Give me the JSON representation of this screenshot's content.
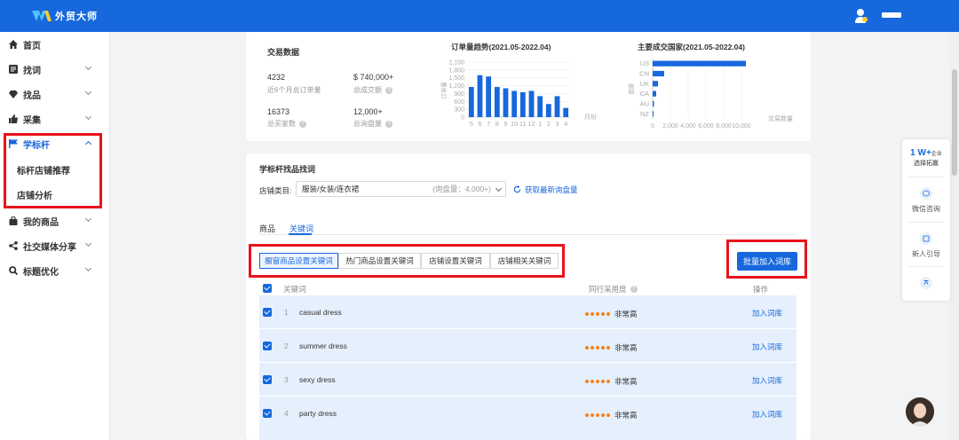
{
  "app": {
    "title": "外贸大师"
  },
  "sidebar": {
    "items": [
      {
        "label": "首页"
      },
      {
        "label": "找词"
      },
      {
        "label": "找品"
      },
      {
        "label": "采集"
      },
      {
        "label": "学标杆"
      },
      {
        "label": "我的商品"
      },
      {
        "label": "社交媒体分享"
      },
      {
        "label": "标题优化"
      }
    ],
    "subitems": [
      {
        "label": "标杆店铺推荐"
      },
      {
        "label": "店铺分析"
      }
    ]
  },
  "stats": {
    "title": "交易数据",
    "items": [
      {
        "value": "4232",
        "label": "近6个月总订单量"
      },
      {
        "value": "$ 740,000+",
        "label": "总成交额"
      },
      {
        "value": "16373",
        "label": "总买家数"
      },
      {
        "value": "12,000+",
        "label": "总询盘量"
      }
    ]
  },
  "chart_data": [
    {
      "type": "bar",
      "title": "订单量趋势(2021.05-2022.04)",
      "xlabel": "月份",
      "ylabel": "订单量",
      "categories": [
        "5",
        "6",
        "7",
        "8",
        "9",
        "10",
        "11",
        "12",
        "1",
        "2",
        "3",
        "4"
      ],
      "values": [
        1150,
        1600,
        1550,
        1150,
        1100,
        1000,
        950,
        1000,
        800,
        500,
        800,
        350
      ],
      "yticks": [
        "2,100",
        "1,800",
        "1,500",
        "1,200",
        "900",
        "600",
        "300",
        "0"
      ],
      "ylim": [
        0,
        2100
      ],
      "color": "#1668dc"
    },
    {
      "type": "bar",
      "orientation": "horizontal",
      "title": "主要成交国家(2021.05-2022.04)",
      "xlabel": "交易数量",
      "ylabel": "国家",
      "categories": [
        "US",
        "CN",
        "UK",
        "CA",
        "AU",
        "NZ"
      ],
      "values": [
        10500,
        1300,
        600,
        400,
        150,
        100
      ],
      "xticks": [
        "0",
        "2,000",
        "4,000",
        "6,000",
        "8,000",
        "10,000"
      ],
      "xlim": [
        0,
        12000
      ],
      "color": "#1668dc"
    }
  ],
  "keyword_finder": {
    "title": "学标杆找品找词",
    "category_label": "店铺类目:",
    "category_value": "服装/女装/连衣裙",
    "inquiry_hint": "(询盘量：4,000+)",
    "refresh_link": "获取最新询盘量",
    "tabs": [
      {
        "label": "商品"
      },
      {
        "label": "关键词"
      }
    ],
    "segments": [
      {
        "label": "橱窗商品设置关键词"
      },
      {
        "label": "热门商品设置关键词"
      },
      {
        "label": "店铺设置关键词"
      },
      {
        "label": "店铺相关关键词"
      }
    ],
    "batch_button": "批量加入词库",
    "columns": {
      "keyword": "关键词",
      "usage": "同行采用度",
      "action": "操作"
    },
    "rows": [
      {
        "index": "1",
        "keyword": "casual dress",
        "usage": "非常高",
        "action": "加入词库"
      },
      {
        "index": "2",
        "keyword": "summer dress",
        "usage": "非常高",
        "action": "加入词库"
      },
      {
        "index": "3",
        "keyword": "sexy dress",
        "usage": "非常高",
        "action": "加入词库"
      },
      {
        "index": "4",
        "keyword": "party dress",
        "usage": "非常高",
        "action": "加入词库"
      }
    ]
  },
  "float_panel": {
    "top_number": "1 W+",
    "top_suffix": "企业",
    "top_caption": "选择拓赢",
    "items": [
      {
        "label": "微信咨询"
      },
      {
        "label": "新人引导"
      }
    ]
  }
}
